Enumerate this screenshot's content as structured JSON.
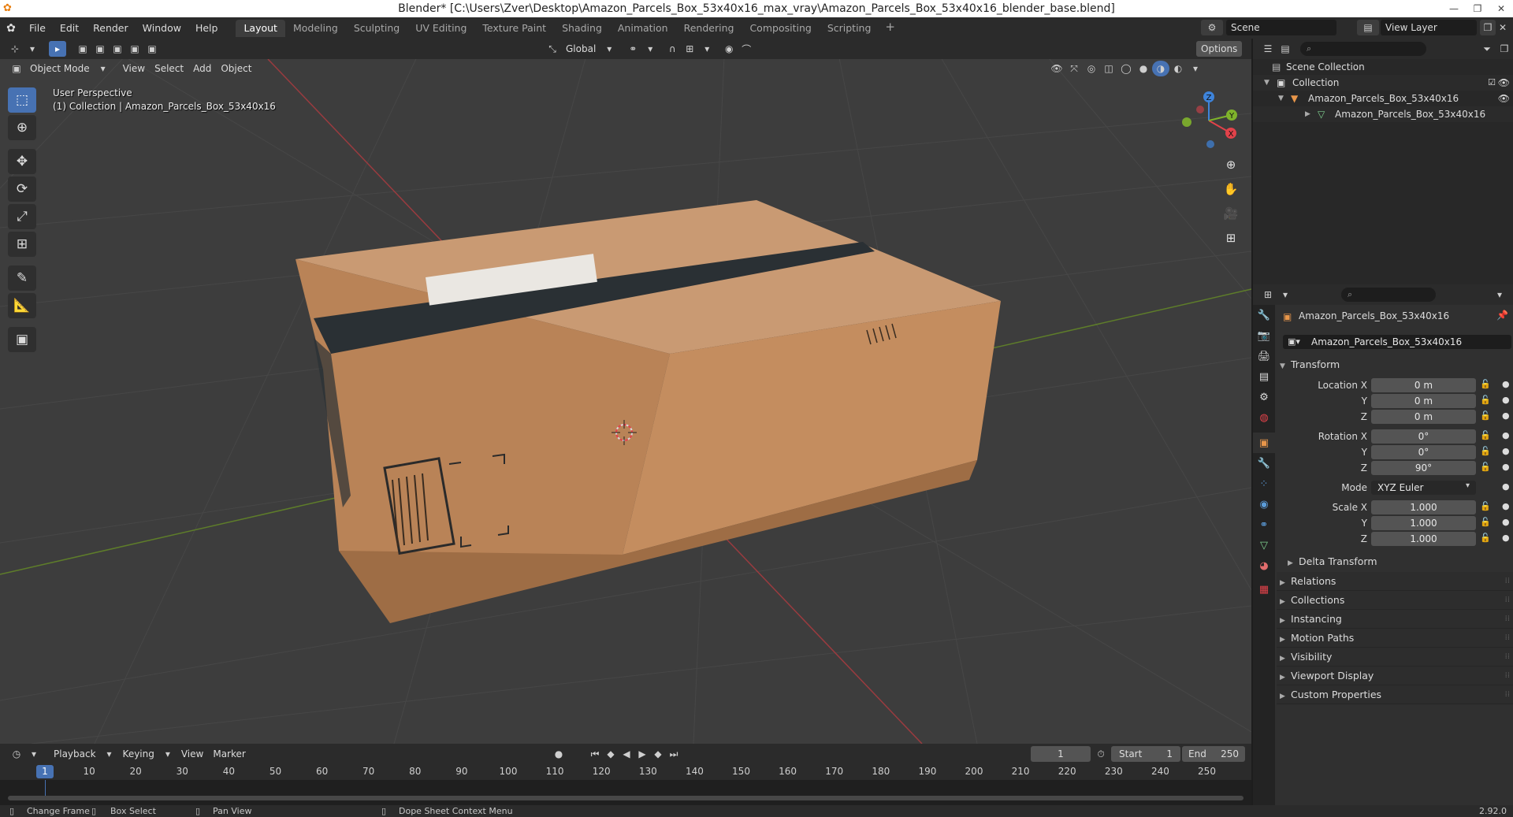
{
  "window": {
    "title": "Blender* [C:\\Users\\Zver\\Desktop\\Amazon_Parcels_Box_53x40x16_max_vray\\Amazon_Parcels_Box_53x40x16_blender_base.blend]"
  },
  "menu": [
    "File",
    "Edit",
    "Render",
    "Window",
    "Help"
  ],
  "workspaces": {
    "tabs": [
      "Layout",
      "Modeling",
      "Sculpting",
      "UV Editing",
      "Texture Paint",
      "Shading",
      "Animation",
      "Rendering",
      "Compositing",
      "Scripting"
    ],
    "active": "Layout"
  },
  "scene": {
    "label": "Scene",
    "view_layer": "View Layer"
  },
  "viewport": {
    "mode": "Object Mode",
    "menus": [
      "View",
      "Select",
      "Add",
      "Object"
    ],
    "orientation": "Global",
    "options": "Options",
    "perspective_label": "User Perspective",
    "collection_label": "(1) Collection | Amazon_Parcels_Box_53x40x16",
    "gizmo_axes": {
      "x": "X",
      "y": "Y",
      "z": "Z"
    }
  },
  "outliner": {
    "rows": [
      {
        "label": "Scene Collection"
      },
      {
        "label": "Collection"
      },
      {
        "label": "Amazon_Parcels_Box_53x40x16"
      },
      {
        "label": "Amazon_Parcels_Box_53x40x16"
      }
    ]
  },
  "properties": {
    "object_name": "Amazon_Parcels_Box_53x40x16",
    "object_field": "Amazon_Parcels_Box_53x40x16",
    "transform_title": "Transform",
    "location": {
      "label": "Location X",
      "x": "0 m",
      "y": "0 m",
      "z": "0 m"
    },
    "rotation": {
      "label": "Rotation X",
      "x": "0°",
      "y": "0°",
      "z": "90°"
    },
    "mode": {
      "label": "Mode",
      "value": "XYZ Euler"
    },
    "scale": {
      "label": "Scale X",
      "x": "1.000",
      "y": "1.000",
      "z": "1.000"
    },
    "axis_y": "Y",
    "axis_z": "Z",
    "delta_transform": "Delta Transform",
    "panels": [
      "Relations",
      "Collections",
      "Instancing",
      "Motion Paths",
      "Visibility",
      "Viewport Display",
      "Custom Properties"
    ]
  },
  "timeline": {
    "menus": [
      "Playback",
      "Keying",
      "View",
      "Marker"
    ],
    "current_frame": "1",
    "start_label": "Start",
    "start": "1",
    "end_label": "End",
    "end": "250",
    "ruler_current": "1",
    "ticks": [
      "10",
      "20",
      "30",
      "40",
      "50",
      "60",
      "70",
      "80",
      "90",
      "100",
      "110",
      "120",
      "130",
      "140",
      "150",
      "160",
      "170",
      "180",
      "190",
      "200",
      "210",
      "220",
      "230",
      "240",
      "250"
    ]
  },
  "statusbar": {
    "change_frame": "Change Frame",
    "box_select": "Box Select",
    "pan_view": "Pan View",
    "context_menu": "Dope Sheet Context Menu",
    "version": "2.92.0"
  },
  "colors": {
    "accent": "#4772b3",
    "axis_x": "#e2424a",
    "axis_y": "#7fb32b",
    "axis_z": "#3e84db",
    "box_cardboard": "#c0875a",
    "tape": "#2a3034"
  }
}
